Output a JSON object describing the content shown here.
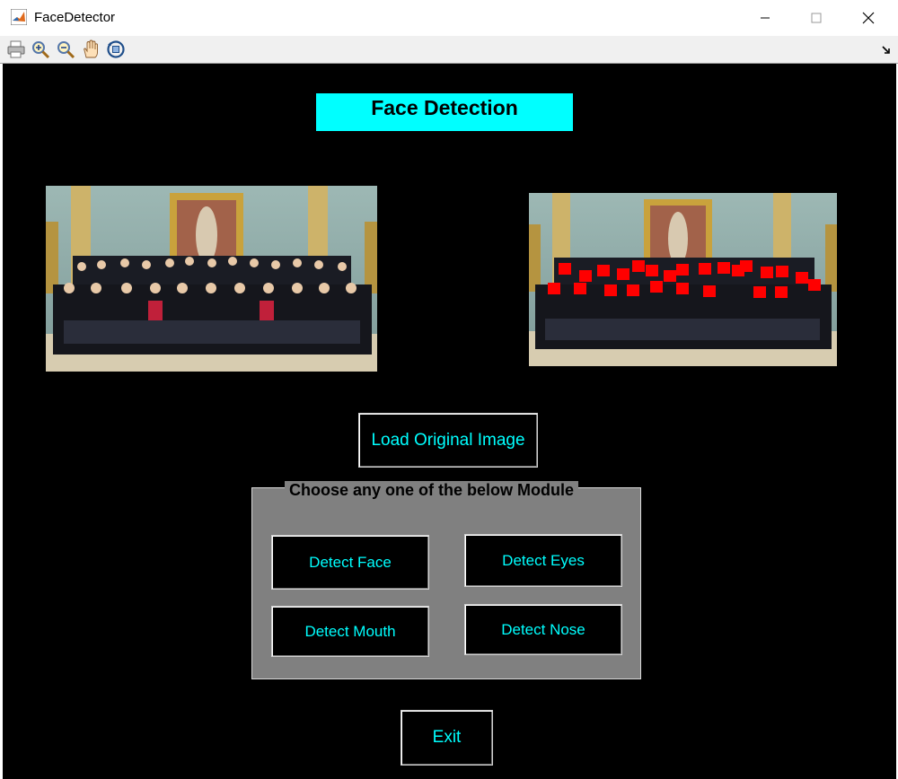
{
  "window": {
    "title": "FaceDetector",
    "icon": "matlab-logo-icon",
    "controls": [
      "minimize-icon",
      "maximize-icon",
      "close-icon"
    ]
  },
  "toolbar": {
    "tools": [
      "print-icon",
      "zoom-in-icon",
      "zoom-out-icon",
      "pan-hand-icon",
      "rotate-3d-icon"
    ],
    "corner": "dock-arrow-icon"
  },
  "main": {
    "heading": "Face Detection",
    "load_button": "Load Original Image",
    "module_panel": {
      "title": "Choose any one of the below Module",
      "buttons": {
        "detect_face": "Detect Face",
        "detect_eyes": "Detect Eyes",
        "detect_mouth": "Detect Mouth",
        "detect_nose": "Detect Nose"
      }
    },
    "exit_button": "Exit"
  },
  "colors": {
    "figure_background": "#000000",
    "heading_background": "#00ffff",
    "button_text": "#00ffff",
    "panel_background": "#808080",
    "detection_box": "#ff0000"
  }
}
